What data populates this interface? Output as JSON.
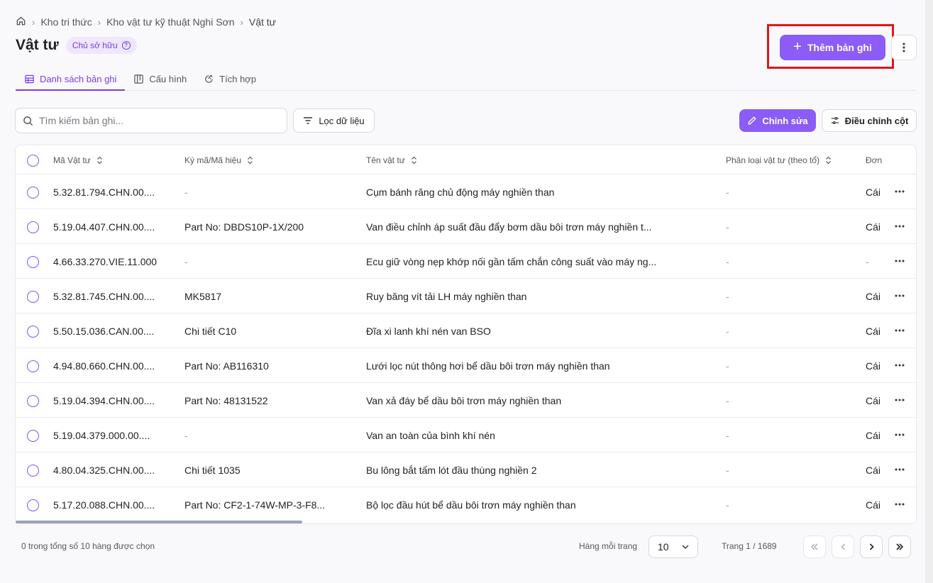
{
  "breadcrumb": {
    "items": [
      "Kho tri thức",
      "Kho vật tư kỹ thuật Nghi Sơn",
      "Vật tư"
    ],
    "separator": ">"
  },
  "header": {
    "title": "Vật tư",
    "badge": "Chủ sở hữu",
    "add_button": "Thêm bản ghi",
    "more_icon": "vertical-ellipsis"
  },
  "tabs": [
    {
      "label": "Danh sách bản ghi",
      "icon": "table-icon",
      "active": true
    },
    {
      "label": "Cấu hình",
      "icon": "layout-icon",
      "active": false
    },
    {
      "label": "Tích hợp",
      "icon": "integration-icon",
      "active": false
    }
  ],
  "toolbar": {
    "search_placeholder": "Tìm kiếm bản ghi...",
    "filter_label": "Lọc dữ liệu",
    "edit_label": "Chỉnh sửa",
    "columns_label": "Điều chỉnh cột"
  },
  "table": {
    "columns": [
      "Mã Vật tư",
      "Ký mã/Mã hiệu",
      "Tên vật tư",
      "Phân loại vật tư (theo tổ)",
      "Đơn"
    ],
    "rows": [
      {
        "code": "5.32.81.794.CHN.00....",
        "mark": "-",
        "name": "Cụm bánh răng chủ động máy nghiền than",
        "category": "-",
        "unit": "Cái"
      },
      {
        "code": "5.19.04.407.CHN.00....",
        "mark": "Part No: DBDS10P-1X/200",
        "name": "Van điều chỉnh áp suất đầu đẩy bơm dầu bôi trơn máy nghiền t...",
        "category": "-",
        "unit": "Cái"
      },
      {
        "code": "4.66.33.270.VIE.11.000",
        "mark": "-",
        "name": "Ecu giữ vòng nẹp khớp nối gần tấm chắn công suất vào máy ng...",
        "category": "-",
        "unit": "-"
      },
      {
        "code": "5.32.81.745.CHN.00....",
        "mark": "MK5817",
        "name": "Ruy băng vít tải LH máy nghiền than",
        "category": "-",
        "unit": "Cái"
      },
      {
        "code": "5.50.15.036.CAN.00....",
        "mark": "Chi tiết C10",
        "name": "Đĩa xi lanh khí nén van BSO",
        "category": "-",
        "unit": "Cái"
      },
      {
        "code": "4.94.80.660.CHN.00....",
        "mark": "Part No: AB116310",
        "name": "Lưới lọc nút thông hơi bể dầu bôi trơn máy nghiền than",
        "category": "-",
        "unit": "Cái"
      },
      {
        "code": "5.19.04.394.CHN.00....",
        "mark": "Part No: 48131522",
        "name": "Van xả đáy bể dầu bôi trơn máy nghiền than",
        "category": "-",
        "unit": "Cái"
      },
      {
        "code": "5.19.04.379.000.00....",
        "mark": "-",
        "name": "Van an toàn của bình khí nén",
        "category": "-",
        "unit": "Cái"
      },
      {
        "code": "4.80.04.325.CHN.00....",
        "mark": "Chi tiết 1035",
        "name": "Bu lông bắt tấm lót đầu thùng nghiền 2",
        "category": "-",
        "unit": "Cái"
      },
      {
        "code": "5.17.20.088.CHN.00....",
        "mark": "Part No: CF2-1-74W-MP-3-F8...",
        "name": "Bộ lọc đầu hút bể dầu bôi trơn máy nghiền than",
        "category": "-",
        "unit": "Cái"
      }
    ]
  },
  "footer": {
    "selected_text": "0 trong tổng số 10 hàng được chọn",
    "rows_per_page_label": "Hàng mỗi trang",
    "rows_per_page_value": "10",
    "page_info": "Trang 1 / 1689"
  },
  "colors": {
    "accent": "#8b5cf6",
    "highlight": "#e0161b"
  }
}
